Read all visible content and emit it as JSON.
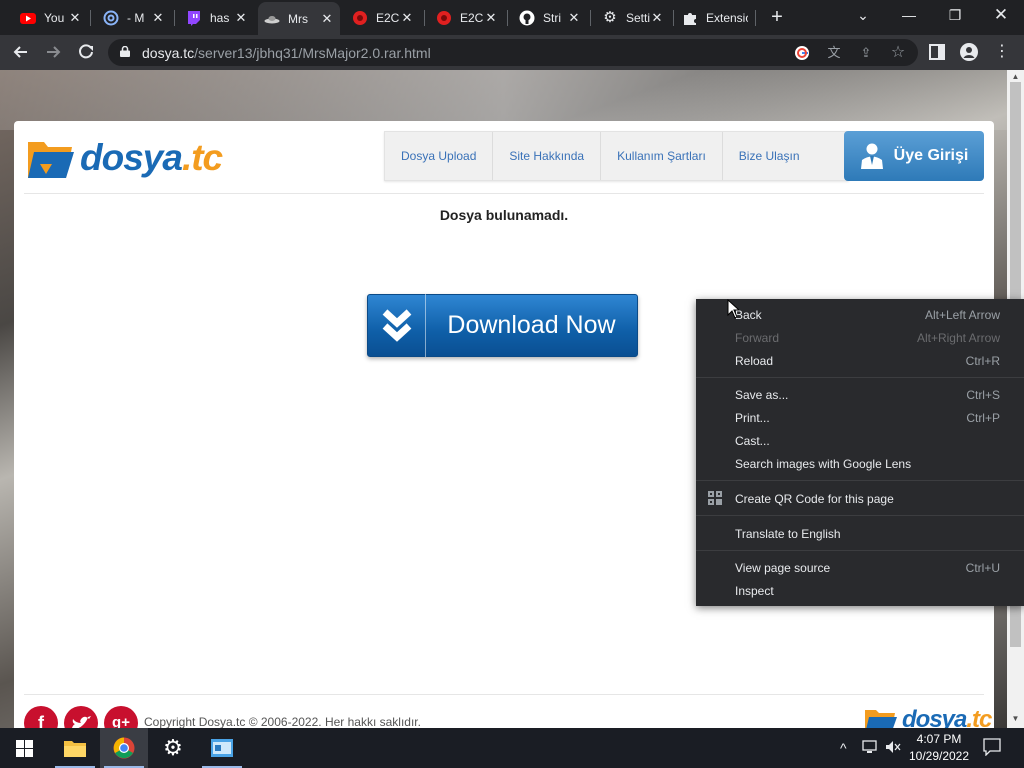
{
  "browser": {
    "tabs": [
      {
        "title": "You",
        "icon": "youtube-icon",
        "color": "#ff0000"
      },
      {
        "title": "- M",
        "icon": "at-sign-icon",
        "color": "#8ab4f8"
      },
      {
        "title": "has",
        "icon": "twitch-icon",
        "color": "#9146ff"
      },
      {
        "title": "Mrs",
        "icon": "ufo-icon",
        "color": "#cccccc",
        "active": true
      },
      {
        "title": "E2C",
        "icon": "red-circle-icon",
        "color": "#e02020"
      },
      {
        "title": "E2C",
        "icon": "red-circle-icon",
        "color": "#e02020"
      },
      {
        "title": "Stri",
        "icon": "github-icon",
        "color": "#ffffff"
      },
      {
        "title": "Setti",
        "icon": "gear-icon",
        "color": "#e8eaed"
      },
      {
        "title": "Extensio",
        "icon": "puzzle-icon",
        "color": "#e8eaed"
      }
    ],
    "url_host": "dosya.tc",
    "url_path": "/server13/jbhq31/MrsMajor2.0.rar.html"
  },
  "site": {
    "logo_main": "dosya",
    "logo_tld": ".tc",
    "nav": [
      "Dosya Upload",
      "Site Hakkında",
      "Kullanım Şartları",
      "Bize Ulaşın"
    ],
    "login_label": "Üye Girişi",
    "message": "Dosya bulunamadı.",
    "download_label": "Download Now",
    "copyright": "Copyright Dosya.tc © 2006-2022. Her hakkı saklıdır.",
    "colors": {
      "brand_blue": "#1a6ab5",
      "brand_orange": "#f39c1f"
    }
  },
  "context_menu": {
    "items": [
      {
        "label": "Back",
        "shortcut": "Alt+Left Arrow"
      },
      {
        "label": "Forward",
        "shortcut": "Alt+Right Arrow",
        "disabled": true
      },
      {
        "label": "Reload",
        "shortcut": "Ctrl+R"
      },
      {
        "label": "Save as...",
        "shortcut": "Ctrl+S"
      },
      {
        "label": "Print...",
        "shortcut": "Ctrl+P"
      },
      {
        "label": "Cast...",
        "shortcut": ""
      },
      {
        "label": "Search images with Google Lens",
        "shortcut": ""
      },
      {
        "label": "Create QR Code for this page",
        "shortcut": "",
        "icon": "qr-code-icon"
      },
      {
        "label": "Translate to English",
        "shortcut": ""
      },
      {
        "label": "View page source",
        "shortcut": "Ctrl+U"
      },
      {
        "label": "Inspect",
        "shortcut": ""
      }
    ]
  },
  "taskbar": {
    "time": "4:07 PM",
    "date": "10/29/2022"
  }
}
